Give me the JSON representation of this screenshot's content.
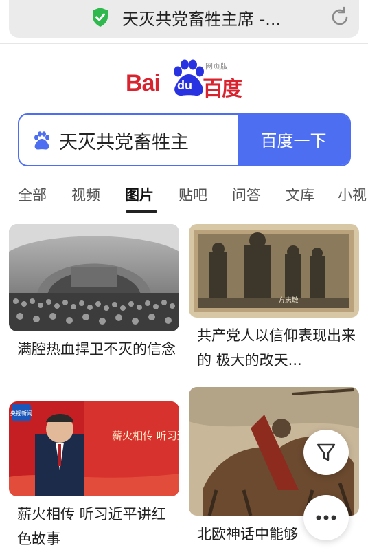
{
  "browser": {
    "url_title": "天灭共党畜牲主席 -...",
    "secure_icon": "shield-check-icon",
    "reload_icon": "reload-icon"
  },
  "logo": {
    "part1": "Bai",
    "part2": "du",
    "part3": "百度",
    "tag": "网页版"
  },
  "search": {
    "query": "天灭共党畜牲主席",
    "button_label": "百度一下"
  },
  "tabs": [
    {
      "label": "全部",
      "active": false
    },
    {
      "label": "视频",
      "active": false
    },
    {
      "label": "图片",
      "active": true
    },
    {
      "label": "贴吧",
      "active": false
    },
    {
      "label": "问答",
      "active": false
    },
    {
      "label": "文库",
      "active": false
    },
    {
      "label": "小视",
      "active": false
    }
  ],
  "results": [
    {
      "title": "满腔热血捍卫不灭的信念",
      "image_text": ""
    },
    {
      "title": "共产党人以信仰表现出来的 极大的改天...",
      "image_text": "方志敏"
    },
    {
      "title": "薪火相传 听习近平讲红色故事",
      "image_text": "薪火相传 听习近平讲 红色故事",
      "badge": "央视新闻"
    },
    {
      "title": "北欧神话中能够",
      "image_text": ""
    }
  ],
  "fabs": {
    "filter_icon": "filter-icon",
    "more_icon": "more-dots-icon"
  },
  "colors": {
    "brand_blue": "#4e6ef2",
    "brand_red": "#d9232e"
  }
}
